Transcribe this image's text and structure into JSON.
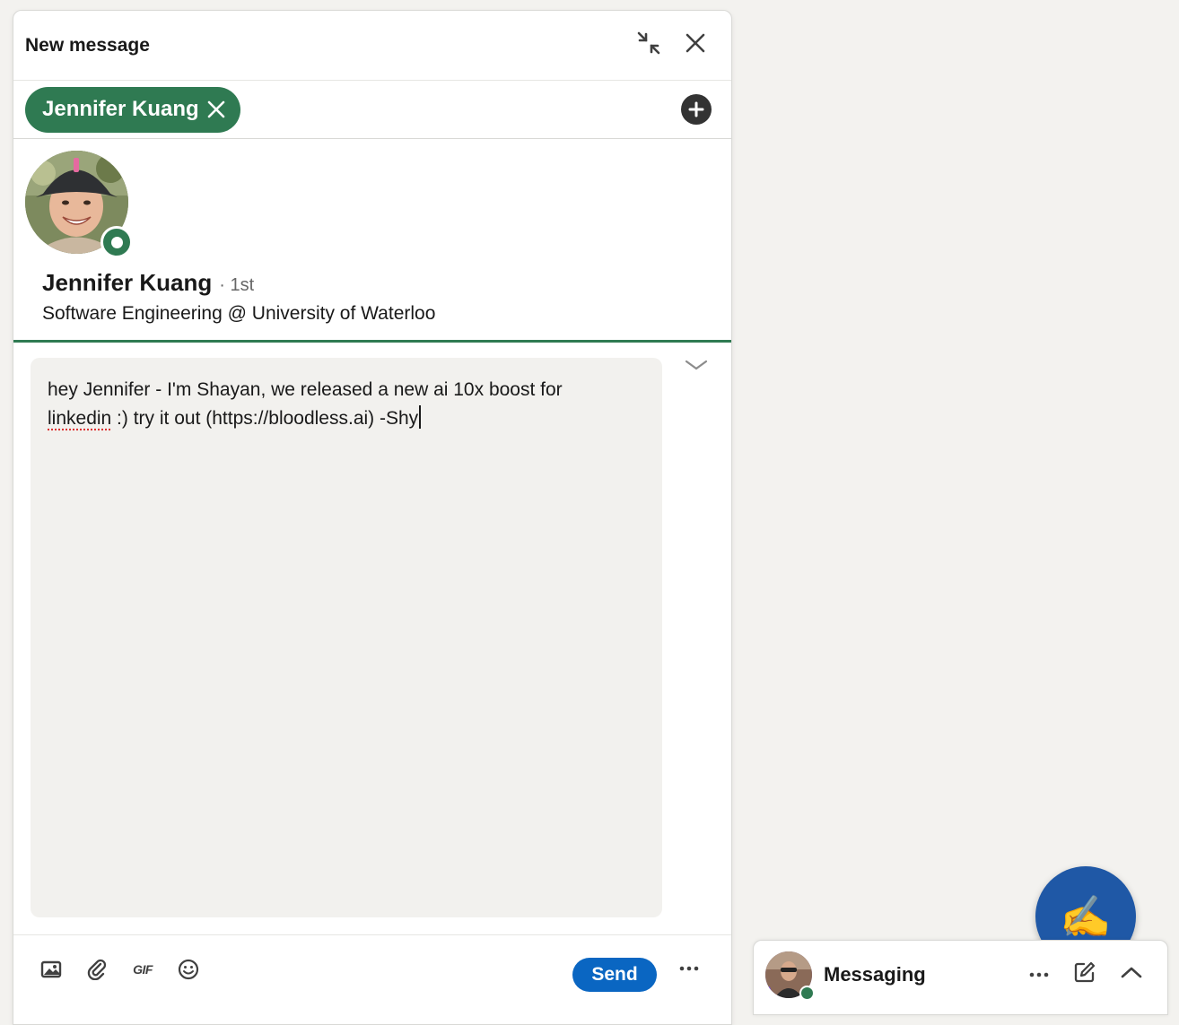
{
  "compose": {
    "title": "New message",
    "recipient_chip": "Jennifer Kuang"
  },
  "profile": {
    "name": "Jennifer Kuang",
    "degree": "· 1st",
    "headline": "Software Engineering @ University of Waterloo"
  },
  "message": {
    "line1": "hey Jennifer - I'm Shayan, we released a new ai 10x boost for",
    "misspelled_word": "linkedin",
    "line2_rest": " :) try it out (https://bloodless.ai) -Shy"
  },
  "footer": {
    "send_label": "Send",
    "gif_label": "GIF"
  },
  "messaging": {
    "title": "Messaging"
  },
  "fab": {
    "emoji": "✍️"
  },
  "colors": {
    "brand_green": "#2f7a52",
    "send_blue": "#0a66c2",
    "fab_blue": "#1f58a6",
    "page_bg": "#f3f2ef"
  }
}
